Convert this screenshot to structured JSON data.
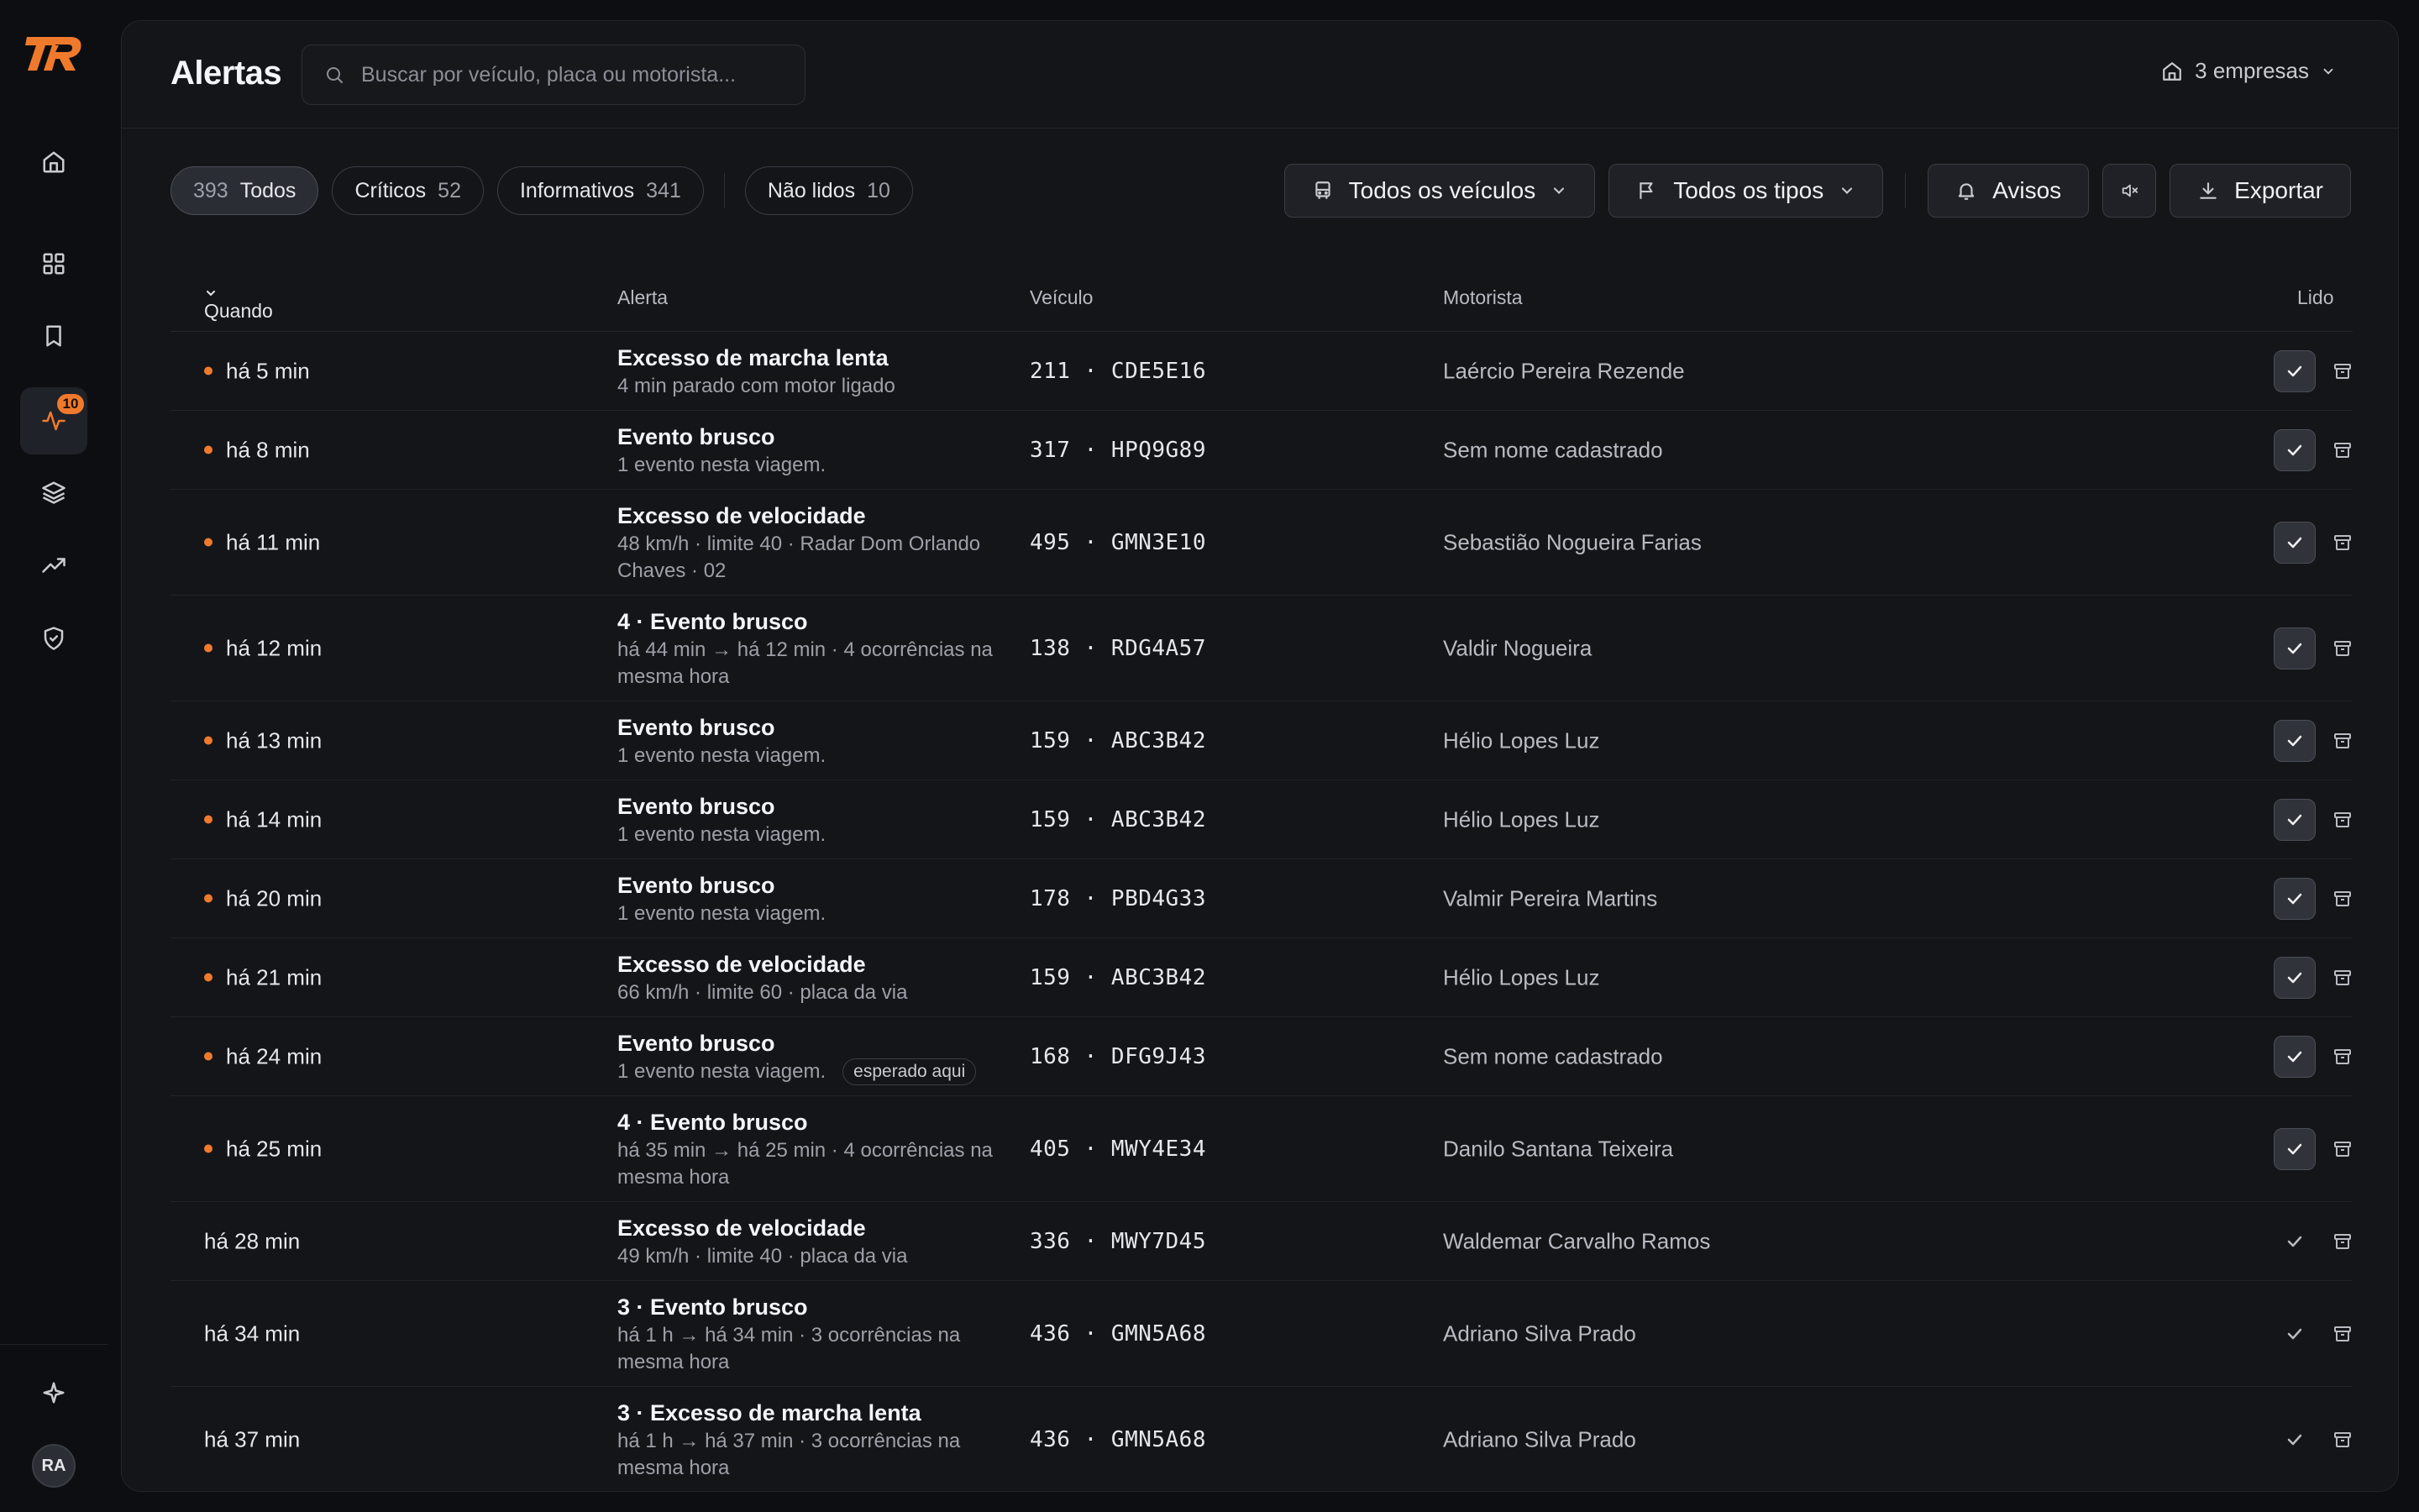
{
  "app": {
    "logo": "TR",
    "accent": "#f07a2c"
  },
  "rail": {
    "items": [
      {
        "name": "home-icon"
      },
      {
        "name": "grid-icon"
      },
      {
        "name": "bookmark-icon"
      },
      {
        "name": "activity-icon",
        "badge": "10",
        "active": true
      },
      {
        "name": "layers-icon"
      },
      {
        "name": "trending-icon"
      },
      {
        "name": "shield-check-icon"
      }
    ],
    "bottom": {
      "sparkle": "sparkle-icon",
      "avatar": "RA"
    }
  },
  "header": {
    "title": "Alertas",
    "search_placeholder": "Buscar por veículo, placa ou motorista...",
    "company_label": "3 empresas"
  },
  "filters": {
    "chips": [
      {
        "count": "393",
        "label": "Todos",
        "active": true
      },
      {
        "label": "Críticos",
        "count": "52"
      },
      {
        "label": "Informativos",
        "count": "341"
      },
      {
        "label": "Não lidos",
        "count": "10"
      }
    ],
    "vehicles": "Todos os veículos",
    "types": "Todos os tipos",
    "notices": "Avisos",
    "export": "Exportar"
  },
  "table": {
    "headers": {
      "when": "Quando",
      "alert": "Alerta",
      "vehicle": "Veículo",
      "driver": "Motorista",
      "read": "Lido"
    },
    "rows": [
      {
        "when": "há 5 min",
        "unread": true,
        "title": "Excesso de marcha lenta",
        "sub": "4 min parado com motor ligado",
        "vehicle": "211 · CDE5E16",
        "driver": "Laércio Pereira Rezende",
        "tall": false
      },
      {
        "when": "há 8 min",
        "unread": true,
        "title": "Evento brusco",
        "sub": "1 evento nesta viagem.",
        "vehicle": "317 · HPQ9G89",
        "driver": "Sem nome cadastrado",
        "tall": false
      },
      {
        "when": "há 11 min",
        "unread": true,
        "title": "Excesso de velocidade",
        "sub": "48 km/h · limite 40 · Radar Dom Orlando Chaves · 02",
        "vehicle": "495 · GMN3E10",
        "driver": "Sebastião Nogueira Farias",
        "tall": true
      },
      {
        "when": "há 12 min",
        "unread": true,
        "title": "4 · Evento brusco",
        "sub": "há 44 min → há 12 min · 4 ocorrências na mesma hora",
        "vehicle": "138 · RDG4A57",
        "driver": "Valdir Nogueira",
        "tall": true
      },
      {
        "when": "há 13 min",
        "unread": true,
        "title": "Evento brusco",
        "sub": "1 evento nesta viagem.",
        "vehicle": "159 · ABC3B42",
        "driver": "Hélio Lopes Luz",
        "tall": false
      },
      {
        "when": "há 14 min",
        "unread": true,
        "title": "Evento brusco",
        "sub": "1 evento nesta viagem.",
        "vehicle": "159 · ABC3B42",
        "driver": "Hélio Lopes Luz",
        "tall": false
      },
      {
        "when": "há 20 min",
        "unread": true,
        "title": "Evento brusco",
        "sub": "1 evento nesta viagem.",
        "vehicle": "178 · PBD4G33",
        "driver": "Valmir Pereira Martins",
        "tall": false
      },
      {
        "when": "há 21 min",
        "unread": true,
        "title": "Excesso de velocidade",
        "sub": "66 km/h · limite 60 · placa da via",
        "vehicle": "159 · ABC3B42",
        "driver": "Hélio Lopes Luz",
        "tall": false
      },
      {
        "when": "há 24 min",
        "unread": true,
        "title": "Evento brusco",
        "sub": "1 evento nesta viagem.",
        "tag": "esperado aqui",
        "vehicle": "168 · DFG9J43",
        "driver": "Sem nome cadastrado",
        "tall": false
      },
      {
        "when": "há 25 min",
        "unread": true,
        "title": "4 · Evento brusco",
        "sub": "há 35 min → há 25 min · 4 ocorrências na mesma hora",
        "vehicle": "405 · MWY4E34",
        "driver": "Danilo Santana Teixeira",
        "tall": true
      },
      {
        "when": "há 28 min",
        "unread": false,
        "title": "Excesso de velocidade",
        "sub": "49 km/h · limite 40 · placa da via",
        "vehicle": "336 · MWY7D45",
        "driver": "Waldemar Carvalho Ramos",
        "tall": false
      },
      {
        "when": "há 34 min",
        "unread": false,
        "title": "3 · Evento brusco",
        "sub": "há 1 h → há 34 min · 3 ocorrências na mesma hora",
        "vehicle": "436 · GMN5A68",
        "driver": "Adriano Silva Prado",
        "tall": true
      },
      {
        "when": "há 37 min",
        "unread": false,
        "title": "3 · Excesso de marcha lenta",
        "sub": "há 1 h → há 37 min · 3 ocorrências na mesma hora",
        "vehicle": "436 · GMN5A68",
        "driver": "Adriano Silva Prado",
        "tall": true
      }
    ],
    "peek_title": "Excesso de marcha lenta"
  }
}
